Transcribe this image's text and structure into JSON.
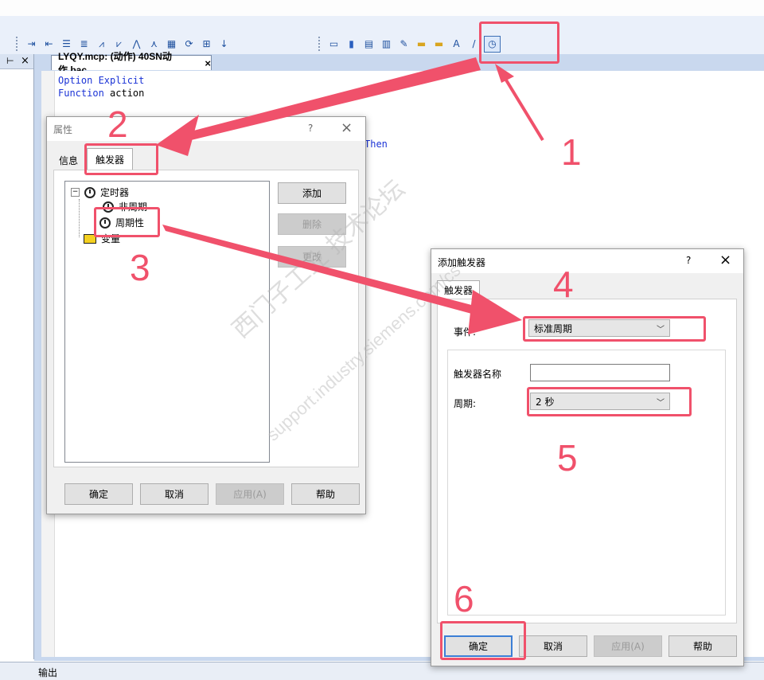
{
  "toolbar": {
    "group1_icons": [
      "indent-icon",
      "outdent-icon",
      "list-icon",
      "list-indent-icon",
      "marker-a-icon",
      "marker-b-icon",
      "marker-c-icon",
      "marker-d-icon",
      "chart-icon",
      "refresh-icon",
      "compile-icon",
      "run-icon"
    ],
    "group2_icons": [
      "window-icon",
      "database-icon",
      "table-icon",
      "grid-icon",
      "edit-icon",
      "folder-icon",
      "folder-add-icon",
      "font-icon",
      "pen-icon",
      "timer-icon"
    ]
  },
  "left_panel": {
    "pin_label": "⊢",
    "close_label": "×"
  },
  "editor": {
    "tab_label": "LYQY.mcp: (动作) 40SN动作.bac",
    "tab_close": "×",
    "code_line1_kw": "Option Explicit",
    "code_line2_kw": "Function",
    "code_line2_rest": " action",
    "code_line_then": "Then"
  },
  "status_bar": {
    "label": "输出"
  },
  "properties_dialog": {
    "title": "属性",
    "help_button": "?",
    "close_button": "×",
    "tabs": [
      "信息",
      "触发器"
    ],
    "tree": {
      "root": "定时器",
      "child1": "非周期",
      "child2": "周期性",
      "sibling": "变量"
    },
    "side_buttons": {
      "add": "添加",
      "delete": "删除",
      "modify": "更改"
    },
    "footer_buttons": {
      "ok": "确定",
      "cancel": "取消",
      "apply": "应用(A)",
      "help": "帮助"
    }
  },
  "add_trigger_dialog": {
    "title": "添加触发器",
    "help_button": "?",
    "close_button": "×",
    "tab": "触发器",
    "event_label": "事件:",
    "event_value": "标准周期",
    "trigger_name_label": "触发器名称",
    "trigger_name_value": "",
    "period_label": "周期:",
    "period_value": "2 秒",
    "footer_buttons": {
      "ok": "确定",
      "cancel": "取消",
      "apply": "应用(A)",
      "help": "帮助"
    }
  },
  "annotations": {
    "n1": "1",
    "n2": "2",
    "n3": "3",
    "n4": "4",
    "n5": "5",
    "n6": "6",
    "color": "#f0516b"
  },
  "watermark": {
    "line1": "西门子工业  技术论坛",
    "line2": "support.industry.siemens.com/cs"
  }
}
